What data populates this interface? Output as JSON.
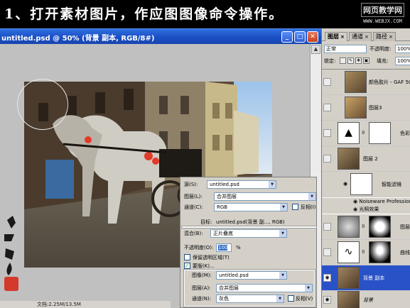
{
  "banner": {
    "title": "1、打开素材图片，作应图图像命令操作。",
    "watermark_line1": "网页教学网",
    "watermark_line2": "WWW.WEBJX.COM"
  },
  "document": {
    "title": "untitled.psd @ 50% (背景 副本, RGB/8#)",
    "status_text": "文档:2.25M/13.5M"
  },
  "dialog": {
    "source_label": "源(S):",
    "source_value": "untitled.psd",
    "layer_label": "图层(L):",
    "layer_value": "合并图层",
    "channel_label": "通道(C):",
    "channel_value": "RGB",
    "invert_label": "反相(I)",
    "target_label": "目标:",
    "target_value": "untitled.psd(背景 副..., RGB)",
    "blending_label": "混合(B):",
    "blending_value": "正片叠底",
    "opacity_label": "不透明度(O):",
    "opacity_value": "100",
    "opacity_unit": "%",
    "preserve_label": "保留透明区域(T)",
    "mask_label": "蒙版(K)...",
    "mask_image_label": "图像(M):",
    "mask_image_value": "untitled.psd",
    "mask_layer_label": "图层(A):",
    "mask_layer_value": "合并图层",
    "mask_channel_label": "通道(N):",
    "mask_channel_value": "灰色",
    "mask_invert_label": "反相(V)"
  },
  "panel": {
    "tabs": [
      {
        "label": "图层"
      },
      {
        "label": "通道"
      },
      {
        "label": "路径"
      }
    ],
    "blend_mode": "正常",
    "opacity_label": "不透明度:",
    "opacity_value": "100%",
    "lock_label": "锁定:",
    "fill_label": "填充:",
    "fill_value": "100%",
    "layers": [
      {
        "name": "颜色胶片 - GAF 50"
      },
      {
        "name": "图层3"
      },
      {
        "name": "色彩"
      },
      {
        "name": "图层 2"
      },
      {
        "name": "智能滤镜"
      },
      {
        "name": "Noiseware Professional"
      },
      {
        "name": "光照效果"
      },
      {
        "name": "图层"
      },
      {
        "name": "曲线"
      },
      {
        "name": "背景 副本"
      },
      {
        "name": "背景"
      }
    ]
  },
  "colors": {
    "title_bar": "#1b4fc4",
    "selected_layer": "#2a52c8",
    "dialog_bg": "#d4d0c8"
  }
}
